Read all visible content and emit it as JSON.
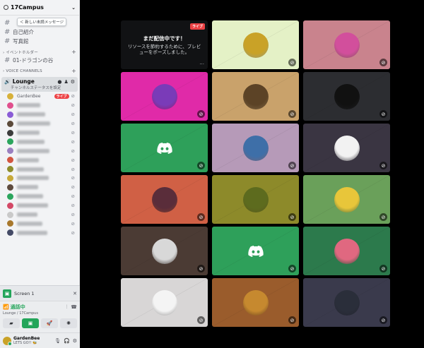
{
  "server": {
    "name": "17Campus",
    "chevron": "chevron-down-icon"
  },
  "tooltip": "＜ 新しい未読メッセージ",
  "channels_top": [
    {
      "name": ""
    },
    {
      "name": "自己紹介"
    },
    {
      "name": "写真館"
    }
  ],
  "categories": {
    "event_holder": "› イベントホルダー",
    "voice": "› VOICE CHANNELS"
  },
  "event_channel": {
    "name": "01-ドラゴンの谷"
  },
  "voice_channel": {
    "name": "Lounge",
    "topic": "チャンネルステータスを設定"
  },
  "members": [
    {
      "name": "GardenBee",
      "live": "ライブ",
      "color": "#d7b13a"
    },
    {
      "name": "",
      "color": "#e04f8d"
    },
    {
      "name": "",
      "color": "#8a5cd6"
    },
    {
      "name": "",
      "color": "#5b4a3a"
    },
    {
      "name": "",
      "color": "#3c3c3c"
    },
    {
      "name": "",
      "color": "#2ba55d"
    },
    {
      "name": "",
      "color": "#9a7fbf"
    },
    {
      "name": "",
      "color": "#d2553f"
    },
    {
      "name": "",
      "color": "#8d8d2c"
    },
    {
      "name": "",
      "color": "#c7a93a"
    },
    {
      "name": "",
      "color": "#5e4b3e"
    },
    {
      "name": "",
      "color": "#2ba55d"
    },
    {
      "name": "",
      "color": "#d34866"
    },
    {
      "name": "",
      "color": "#c9c9c9"
    },
    {
      "name": "",
      "color": "#a8782c"
    },
    {
      "name": "",
      "color": "#444a66"
    }
  ],
  "screen_share": {
    "label": "Screen 1"
  },
  "rtc": {
    "status": "通話中",
    "location": "Lounge / 17Campus"
  },
  "user": {
    "name": "GardenBee",
    "status": "LETS GO!! 🐝"
  },
  "tiles": [
    {
      "kind": "live",
      "title": "まだ配信中です！",
      "subtitle": "リソースを節約するために、プレビューをポーズしました。",
      "badge": "ライブ",
      "dots": "···"
    },
    {
      "kind": "avatar",
      "bg": "#e4f1c6",
      "avatar": "#c9a227",
      "mute": true
    },
    {
      "kind": "avatar",
      "bg": "#c9838d",
      "avatar": "#d24f9c",
      "mute": true
    },
    {
      "kind": "avatar",
      "bg": "#e02aa8",
      "avatar": "#7a3bb8",
      "mute": true
    },
    {
      "kind": "avatar",
      "bg": "#c9a26b",
      "avatar": "#5c4326",
      "mute": true
    },
    {
      "kind": "avatar",
      "bg": "#2c2d31",
      "avatar": "#111111",
      "mute": true
    },
    {
      "kind": "discord",
      "bg": "#2ea05a",
      "mute": true
    },
    {
      "kind": "avatar",
      "bg": "#b69ab8",
      "avatar": "#3e6fa8",
      "mute": true
    },
    {
      "kind": "avatar",
      "bg": "#3a3542",
      "avatar": "#f2f2f2",
      "mute": true
    },
    {
      "kind": "avatar",
      "bg": "#d06045",
      "avatar": "#5a2d3a",
      "mute": true
    },
    {
      "kind": "avatar",
      "bg": "#8d8a2a",
      "avatar": "#5d6b1e",
      "mute": true
    },
    {
      "kind": "avatar",
      "bg": "#6aa05a",
      "avatar": "#e8c63a",
      "mute": true
    },
    {
      "kind": "avatar",
      "bg": "#4b3b34",
      "avatar": "#d8d8d8",
      "mute": true
    },
    {
      "kind": "discord",
      "bg": "#2ea05a",
      "mute": true
    },
    {
      "kind": "avatar",
      "bg": "#2c7a4c",
      "avatar": "#e06880",
      "mute": true
    },
    {
      "kind": "avatar",
      "bg": "#d8d6d6",
      "avatar": "#f4f4f4",
      "mute": true
    },
    {
      "kind": "avatar",
      "bg": "#9a5c2c",
      "avatar": "#c6892f",
      "mute": true
    },
    {
      "kind": "avatar",
      "bg": "#3a3a4c",
      "avatar": "#2a2e3a",
      "mute": true
    }
  ]
}
